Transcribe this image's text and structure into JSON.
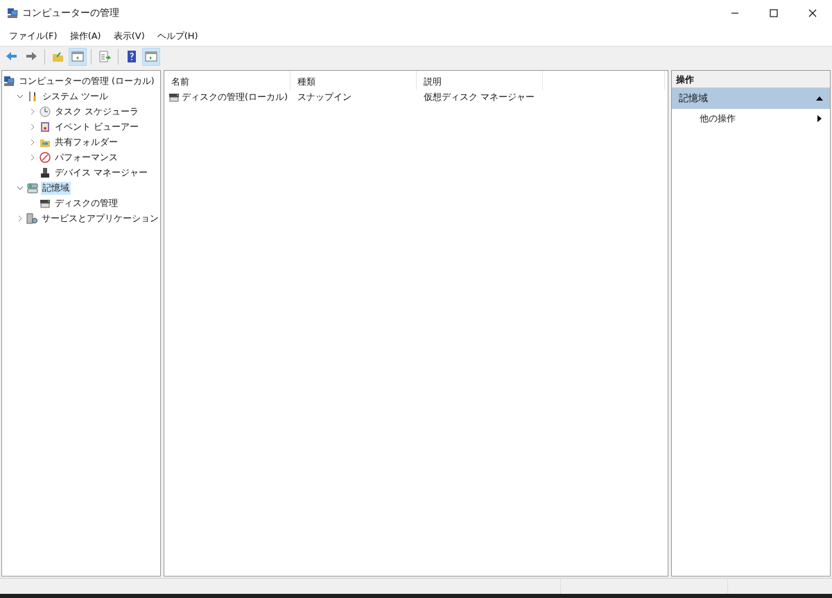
{
  "window": {
    "title": "コンピューターの管理"
  },
  "menu": [
    {
      "label": "ファイル(F)"
    },
    {
      "label": "操作(A)"
    },
    {
      "label": "表示(V)"
    },
    {
      "label": "ヘルプ(H)"
    }
  ],
  "toolbar": [
    {
      "kind": "back",
      "pressed": false
    },
    {
      "kind": "forward",
      "pressed": false
    },
    {
      "kind": "sep"
    },
    {
      "kind": "up",
      "pressed": false
    },
    {
      "kind": "tree",
      "pressed": true
    },
    {
      "kind": "sep"
    },
    {
      "kind": "export",
      "pressed": false
    },
    {
      "kind": "sep"
    },
    {
      "kind": "help",
      "pressed": false
    },
    {
      "kind": "actionpane",
      "pressed": true
    }
  ],
  "tree": [
    {
      "label": "コンピューターの管理 (ローカル)",
      "kind": "computer",
      "selected": false,
      "children": [
        {
          "label": "システム ツール",
          "kind": "tools",
          "expanded": true,
          "selected": false,
          "children": [
            {
              "label": "タスク スケジューラ",
              "kind": "clock",
              "expanded": false,
              "selected": false
            },
            {
              "label": "イベント ビューアー",
              "kind": "event",
              "expanded": false,
              "selected": false
            },
            {
              "label": "共有フォルダー",
              "kind": "folder",
              "expanded": false,
              "selected": false
            },
            {
              "label": "パフォーマンス",
              "kind": "perf",
              "expanded": false,
              "selected": false
            },
            {
              "label": "デバイス マネージャー",
              "kind": "device",
              "selected": false
            }
          ]
        },
        {
          "label": "記憶域",
          "kind": "storage",
          "expanded": true,
          "selected": true,
          "children": [
            {
              "label": "ディスクの管理",
              "kind": "disk",
              "selected": false
            }
          ]
        },
        {
          "label": "サービスとアプリケーション",
          "kind": "services",
          "expanded": false,
          "selected": false
        }
      ]
    }
  ],
  "table": {
    "columns": [
      "名前",
      "種類",
      "説明"
    ],
    "rows": [
      {
        "cells": [
          "ディスクの管理(ローカル)",
          "スナップイン",
          "仮想ディスク マネージャー"
        ]
      }
    ]
  },
  "actions": {
    "title": "操作",
    "section": {
      "label": "記憶域",
      "expanded": true
    },
    "items": [
      {
        "label": "他の操作"
      }
    ]
  }
}
